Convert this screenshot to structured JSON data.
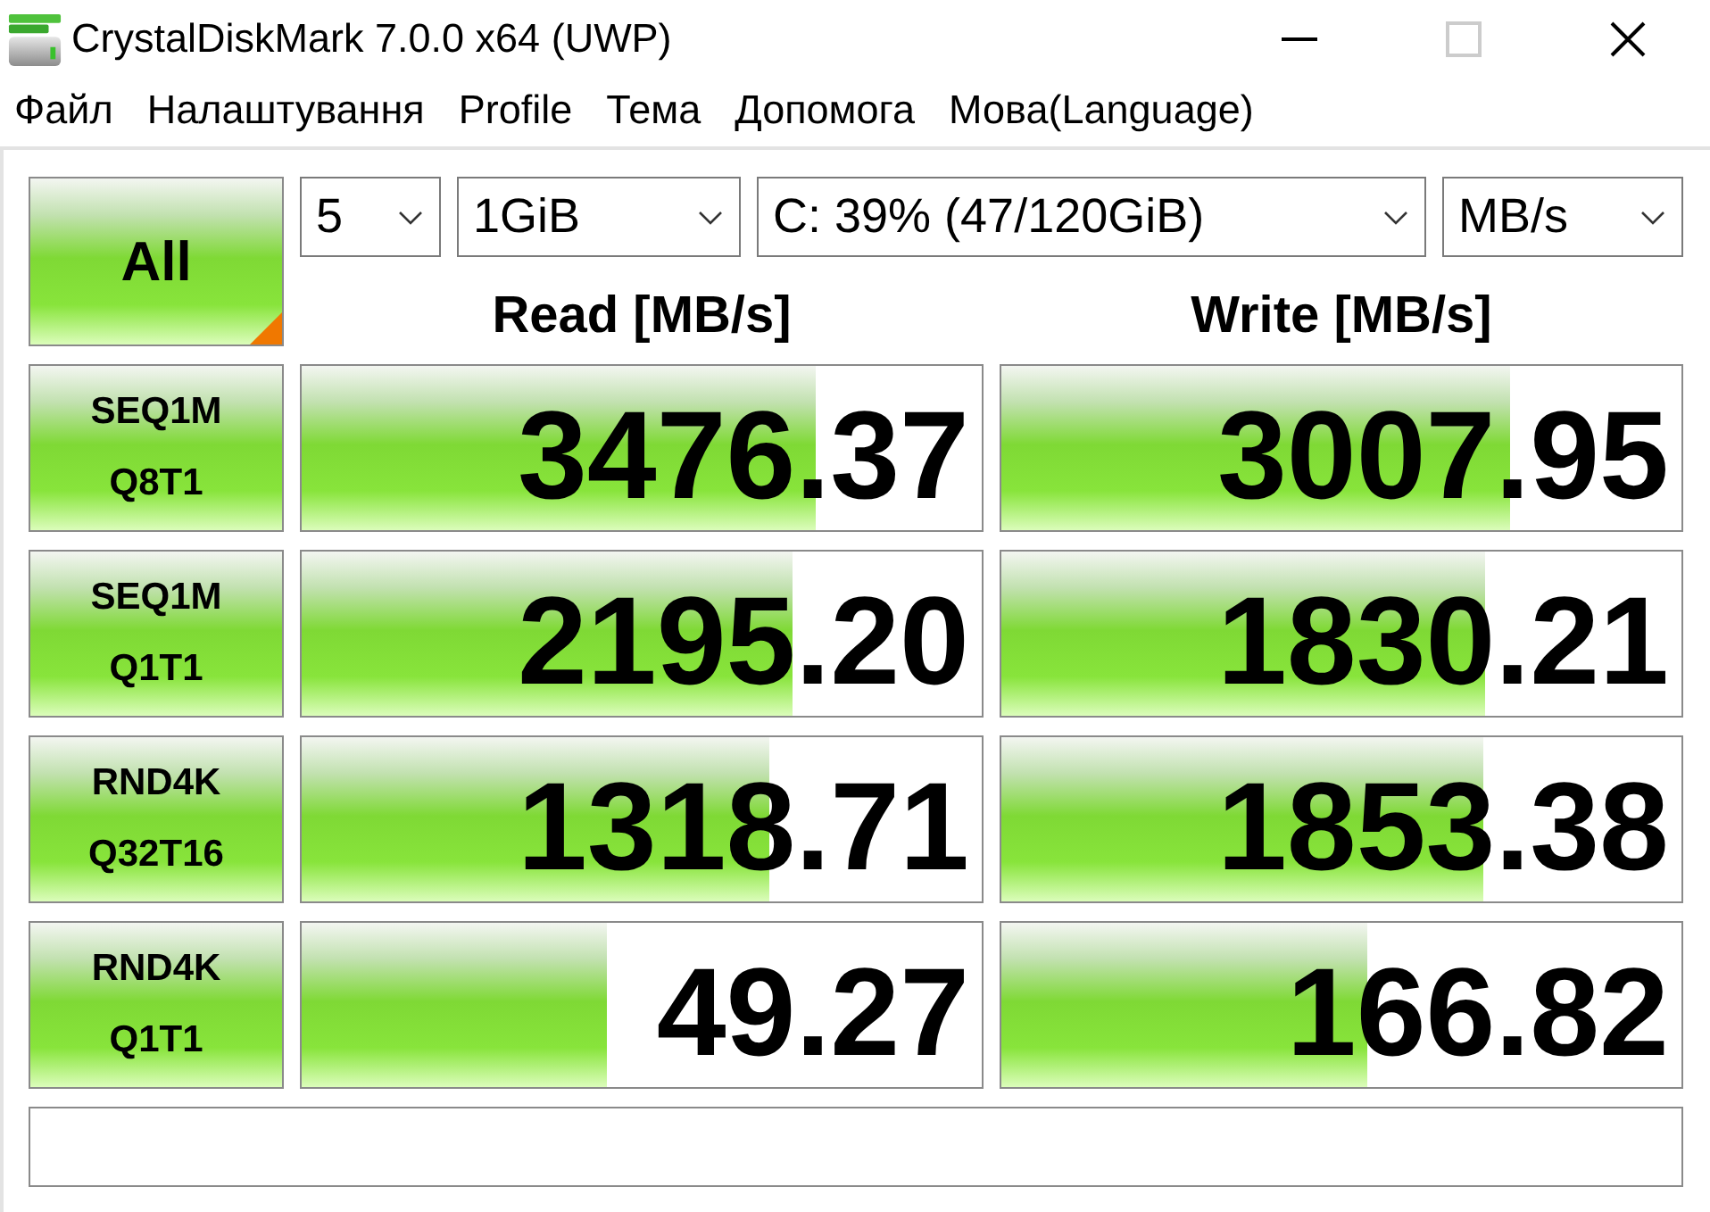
{
  "window": {
    "title": "CrystalDiskMark 7.0.0 x64 (UWP)",
    "maximize_disabled": true
  },
  "menu": [
    {
      "label": "Файл"
    },
    {
      "label": "Налаштування"
    },
    {
      "label": "Profile"
    },
    {
      "label": "Тема"
    },
    {
      "label": "Допомога"
    },
    {
      "label": "Мова(Language)"
    }
  ],
  "all_button": {
    "label": "All"
  },
  "selectors": [
    {
      "value": "5"
    },
    {
      "value": "1GiB"
    },
    {
      "value": "C: 39% (47/120GiB)"
    },
    {
      "value": "MB/s"
    }
  ],
  "columns": [
    {
      "label": "Read [MB/s]"
    },
    {
      "label": "Write [MB/s]"
    }
  ],
  "rows": [
    {
      "test": "SEQ1M",
      "queue_threads": "Q8T1",
      "read": {
        "value": "3476.37",
        "level": 0.757
      },
      "write": {
        "value": "3007.95",
        "level": 0.747
      }
    },
    {
      "test": "SEQ1M",
      "queue_threads": "Q1T1",
      "read": {
        "value": "2195.20",
        "level": 0.723
      },
      "write": {
        "value": "1830.21",
        "level": 0.71
      }
    },
    {
      "test": "RND4K",
      "queue_threads": "Q32T16",
      "read": {
        "value": "1318.71",
        "level": 0.687
      },
      "write": {
        "value": "1853.38",
        "level": 0.708
      }
    },
    {
      "test": "RND4K",
      "queue_threads": "Q1T1",
      "read": {
        "value": "49.27",
        "level": 0.449
      },
      "write": {
        "value": "166.82",
        "level": 0.538
      }
    }
  ]
}
